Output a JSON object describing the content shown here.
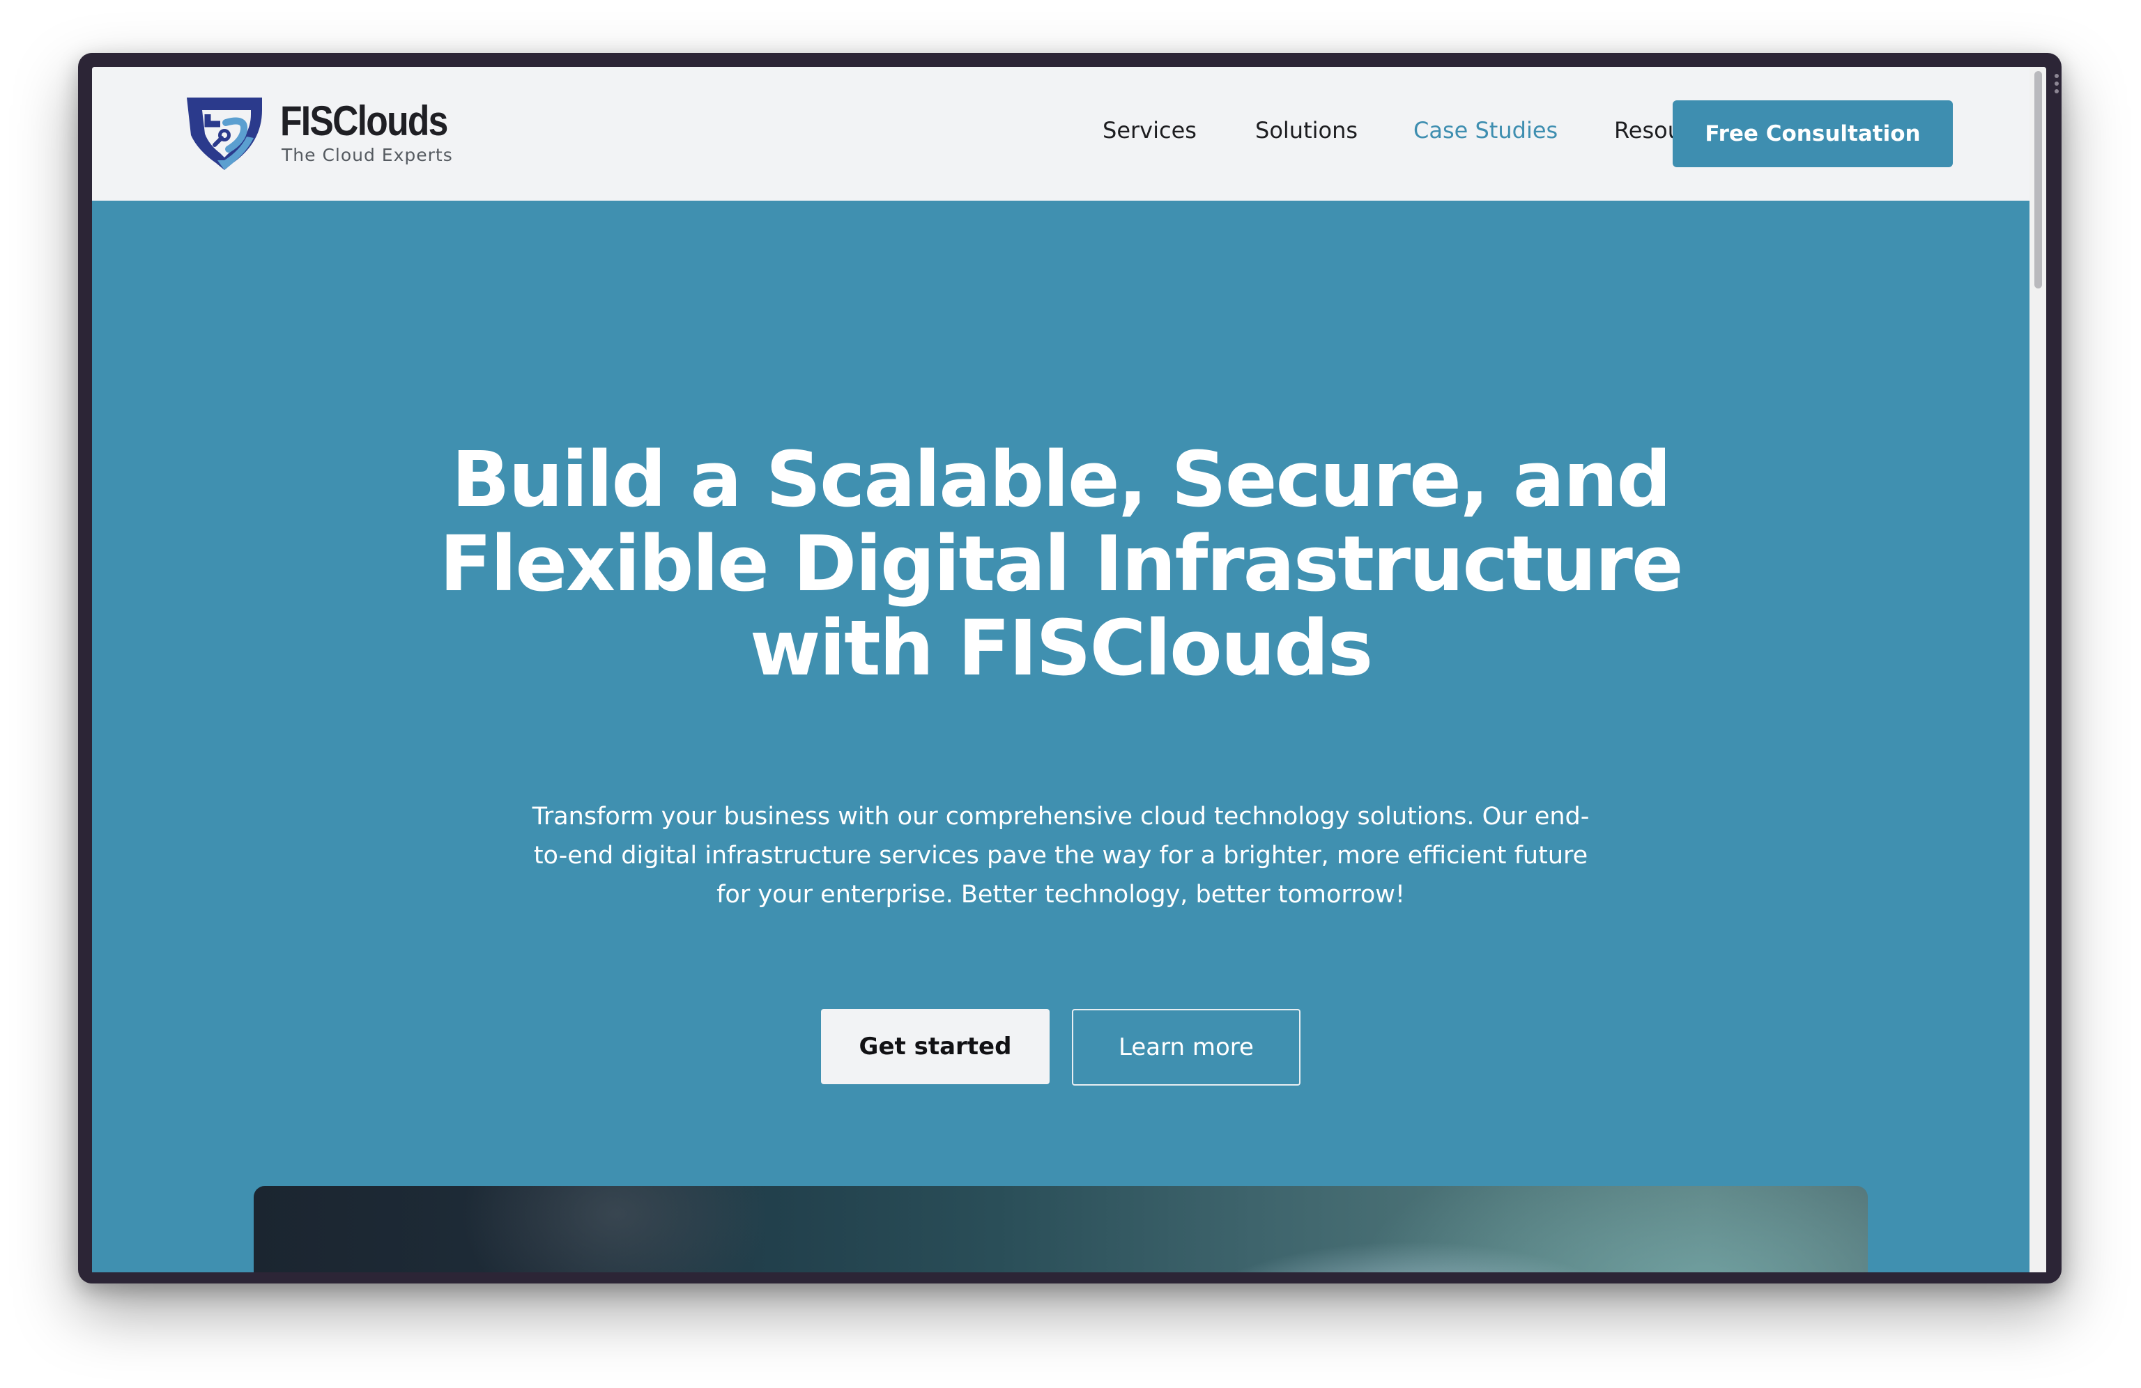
{
  "brand": {
    "name": "FISClouds",
    "tagline": "The Cloud Experts",
    "logo_icon": "shield-logo-icon",
    "colors": {
      "dark": "#2b3a8c",
      "light": "#3e8eb0"
    }
  },
  "nav": {
    "items": [
      {
        "label": "Services",
        "active": false
      },
      {
        "label": "Solutions",
        "active": false
      },
      {
        "label": "Case Studies",
        "active": true
      },
      {
        "label": "Resources",
        "active": false
      }
    ],
    "cta_label": "Free Consultation"
  },
  "hero": {
    "title": "Build a Scalable, Secure, and Flexible Digital Infrastructure with FISClouds",
    "subtitle": "Transform your business with our comprehensive cloud technology solutions. Our end-to-end digital infrastructure services pave the way for a brighter, more efficient future for your enterprise. Better technology, better tomorrow!",
    "primary_button": "Get started",
    "secondary_button": "Learn more"
  },
  "theme": {
    "accent": "#3e8eb0",
    "hero_background": "#4090b0",
    "header_background": "#f2f3f5",
    "frame": "#2c2536"
  }
}
